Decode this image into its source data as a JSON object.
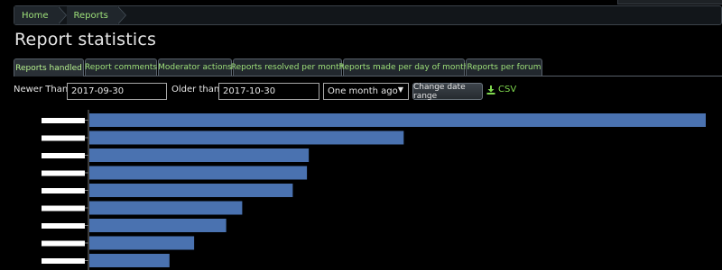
{
  "breadcrumb": {
    "items": [
      "Home",
      "Reports"
    ]
  },
  "page_title": "Report statistics",
  "tabs": [
    {
      "label": "Reports handled",
      "active": true
    },
    {
      "label": "Report comments",
      "active": false
    },
    {
      "label": "Moderator actions",
      "active": false
    },
    {
      "label": "Reports resolved per month",
      "active": false
    },
    {
      "label": "Reports made per day of month",
      "active": false
    },
    {
      "label": "Reports per forum",
      "active": false
    }
  ],
  "filters": {
    "newer_label": "Newer Than:",
    "newer_value": "2017-09-30",
    "older_label": "Older than:",
    "older_value": "2017-10-30",
    "range_selected": "One month ago",
    "change_button": "Change date range",
    "csv_label": "CSV"
  },
  "colors": {
    "accent": "#9ee07a",
    "bar": "#4a72b0",
    "background": "#000000"
  },
  "chart_data": {
    "type": "bar",
    "orientation": "horizontal",
    "categories": [
      "",
      "",
      "",
      "",
      "",
      "",
      "",
      "",
      ""
    ],
    "values": [
      100,
      51,
      35.6,
      35.3,
      33,
      24.8,
      22.2,
      17,
      13
    ],
    "xlim": [
      0,
      100
    ],
    "title": "",
    "xlabel": "",
    "ylabel": "",
    "note_category_labels_redacted": true
  }
}
